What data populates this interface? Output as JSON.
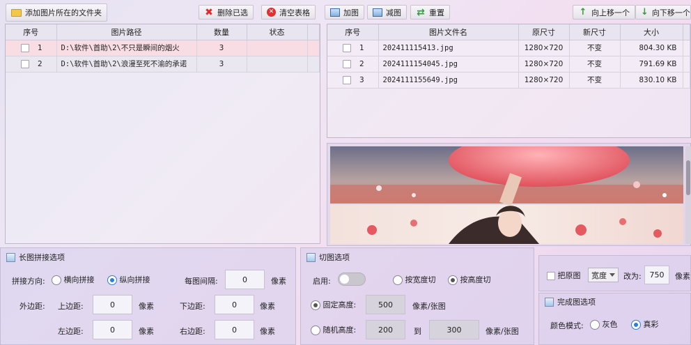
{
  "toolbar": {
    "add_folder": "添加图片所在的文件夹",
    "delete_selected": "删除已选",
    "clear_table": "清空表格",
    "add_image": "加图",
    "remove_image": "减图",
    "reset": "重置",
    "move_up": "向上移一个",
    "move_down": "向下移一个"
  },
  "folder_table": {
    "headers": [
      "序号",
      "图片路径",
      "数量",
      "状态"
    ],
    "rows": [
      {
        "index": "1",
        "path": "D:\\软件\\首助\\2\\不只是瞬间的烟火",
        "count": "3",
        "status": ""
      },
      {
        "index": "2",
        "path": "D:\\软件\\首助\\2\\浪漫至死不渝的承诺",
        "count": "3",
        "status": ""
      }
    ]
  },
  "file_table": {
    "headers": [
      "序号",
      "图片文件名",
      "原尺寸",
      "新尺寸",
      "大小"
    ],
    "rows": [
      {
        "index": "1",
        "name": "202411115413.jpg",
        "orig": "1280×720",
        "new": "不变",
        "size": "804.30 KB"
      },
      {
        "index": "2",
        "name": "2024111154045.jpg",
        "orig": "1280×720",
        "new": "不变",
        "size": "791.69 KB"
      },
      {
        "index": "3",
        "name": "2024111155649.jpg",
        "orig": "1280×720",
        "new": "不变",
        "size": "830.10 KB"
      }
    ]
  },
  "stitch": {
    "title": "长图拼接选项",
    "direction_label": "拼接方向:",
    "horizontal": "横向拼接",
    "vertical": "纵向拼接",
    "gap_label": "每图间隔:",
    "gap_value": "0",
    "margin_label": "外边距:",
    "top_label": "上边距:",
    "top_value": "0",
    "bottom_label": "下边距:",
    "bottom_value": "0",
    "left_label": "左边距:",
    "left_value": "0",
    "right_label": "右边距:",
    "right_value": "0",
    "unit": "像素"
  },
  "cut": {
    "title": "切图选项",
    "enable_label": "启用:",
    "by_width": "按宽度切",
    "by_height": "按高度切",
    "fixed_height": "固定高度:",
    "fixed_value": "500",
    "unit_per": "像素/张图",
    "random_height": "随机高度:",
    "random_from": "200",
    "to": "到",
    "random_to": "300"
  },
  "resize": {
    "checkbox_label": "把原图",
    "select_value": "宽度",
    "change_to": "改为:",
    "value": "750",
    "unit": "像素"
  },
  "finish": {
    "title": "完成图选项",
    "color_label": "颜色模式:",
    "gray": "灰色",
    "true_color": "真彩"
  },
  "colors": {
    "accent": "#2a7fd6",
    "selected_row": "#f9dde4"
  }
}
